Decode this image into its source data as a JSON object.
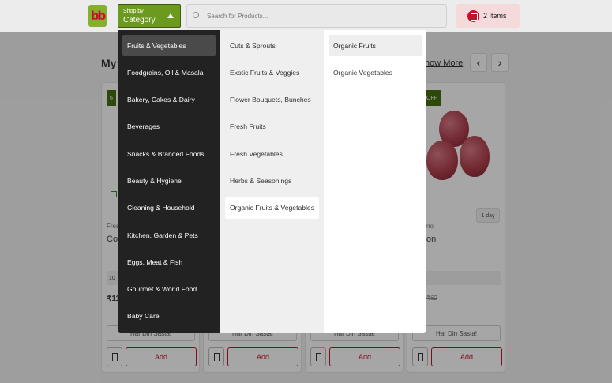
{
  "header": {
    "logo_text": "bb",
    "shop_btn": {
      "line1": "Shop by",
      "line2": "Category"
    },
    "search_placeholder": "Search for Products...",
    "basket_label": "2 Items"
  },
  "page": {
    "section_title_fragment": "My S",
    "show_more_fragment": "how More",
    "prev_arrow": "‹",
    "next_arrow": "›",
    "offer_tag_left": "6",
    "offer_tag_right": "OFF",
    "delivery_chip": "1 day",
    "fragments": {
      "c1_brand": "Fres",
      "c1_name": "Co",
      "c1_qty": "10",
      "c1_price": "₹11",
      "c4_brand": "no",
      "c4_name": "on",
      "c4_price": "₹62"
    },
    "variant_label": "Har Din Sasta!",
    "add_label": "Add"
  },
  "menu": {
    "categories": [
      "Fruits & Vegetables",
      "Foodgrains, Oil & Masala",
      "Bakery, Cakes & Dairy",
      "Beverages",
      "Snacks & Branded Foods",
      "Beauty & Hygiene",
      "Cleaning & Household",
      "Kitchen, Garden & Pets",
      "Eggs, Meat & Fish",
      "Gourmet & World Food",
      "Baby Care"
    ],
    "subcategories": [
      "Cuts & Sprouts",
      "Exotic Fruits & Veggies",
      "Flower Bouquets, Bunches",
      "Fresh Fruits",
      "Fresh Vegetables",
      "Herbs & Seasonings",
      "Organic Fruits & Vegetables"
    ],
    "items": [
      "Organic Fruits",
      "Organic Vegetables"
    ]
  },
  "colors": {
    "brand_green": "#6c9a1f",
    "brand_red": "#c8102e",
    "menu_dark": "#222222"
  }
}
